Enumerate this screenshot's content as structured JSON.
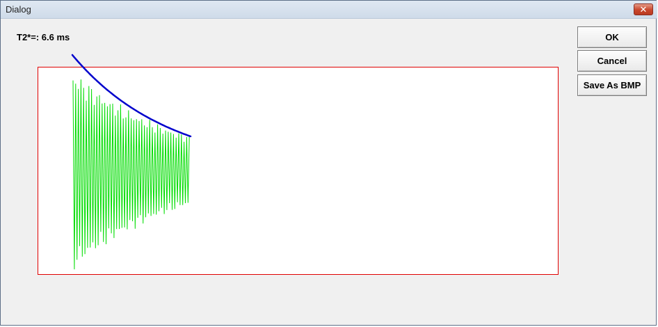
{
  "window": {
    "title": "Dialog",
    "close_glyph": "✕"
  },
  "measurement": {
    "t2_label": "T2*=: 6.6 ms"
  },
  "buttons": {
    "ok": "OK",
    "cancel": "Cancel",
    "save_bmp": "Save As BMP"
  },
  "colors": {
    "frame": "#e00000",
    "signal": "#00dd00",
    "fit": "#0000cc",
    "plot_bg": "#ffffff"
  },
  "chart_data": {
    "type": "line",
    "series": [
      {
        "kind": "oscillating-decay-signal",
        "color": "#00dd00"
      },
      {
        "kind": "exponential-decay-envelope",
        "color": "#0000cc"
      }
    ],
    "t2_star_ms": 6.6
  }
}
